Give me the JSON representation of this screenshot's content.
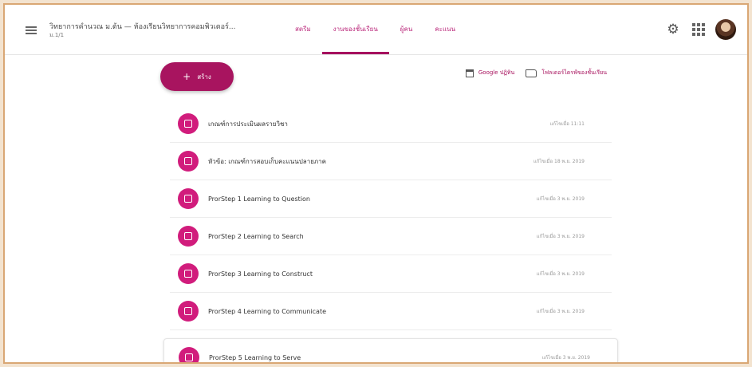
{
  "header": {
    "class_title": "วิทยาการคำนวณ ม.ต้น — ห้องเรียนวิทยาการคอมพิวเตอร์...",
    "class_subtitle": "ม.1/1",
    "tabs": [
      {
        "label": "สตรีม",
        "active": false
      },
      {
        "label": "งานของชั้นเรียน",
        "active": true
      },
      {
        "label": "ผู้คน",
        "active": false
      },
      {
        "label": "คะแนน",
        "active": false
      }
    ]
  },
  "toolbar": {
    "create_label": "สร้าง",
    "calendar_label": "Google ปฏิทิน",
    "folder_label": "โฟลเดอร์ไดรฟ์ของชั้นเรียน"
  },
  "topics": [
    {
      "title": "เกณฑ์การประเมินผลรายวิชา",
      "date": "แก้ไขเมื่อ 11:11"
    },
    {
      "title": "หัวข้อ: เกณฑ์การสอบเก็บคะแนนปลายภาค",
      "date": "แก้ไขเมื่อ 18 พ.ย. 2019"
    },
    {
      "title": "ProrStep 1 Learning to Question",
      "date": "แก้ไขเมื่อ 3 พ.ย. 2019"
    },
    {
      "title": "ProrStep 2 Learning to Search",
      "date": "แก้ไขเมื่อ 3 พ.ย. 2019"
    },
    {
      "title": "ProrStep 3 Learning to Construct",
      "date": "แก้ไขเมื่อ 3 พ.ย. 2019"
    },
    {
      "title": "ProrStep 4 Learning to Communicate",
      "date": "แก้ไขเมื่อ 3 พ.ย. 2019"
    },
    {
      "title": "ProrStep 5 Learning to Serve",
      "date": "แก้ไขเมื่อ 3 พ.ย. 2019"
    }
  ],
  "colors": {
    "accent": "#a8145f",
    "topic_icon": "#d11c7c",
    "frame": "#d9a774"
  }
}
